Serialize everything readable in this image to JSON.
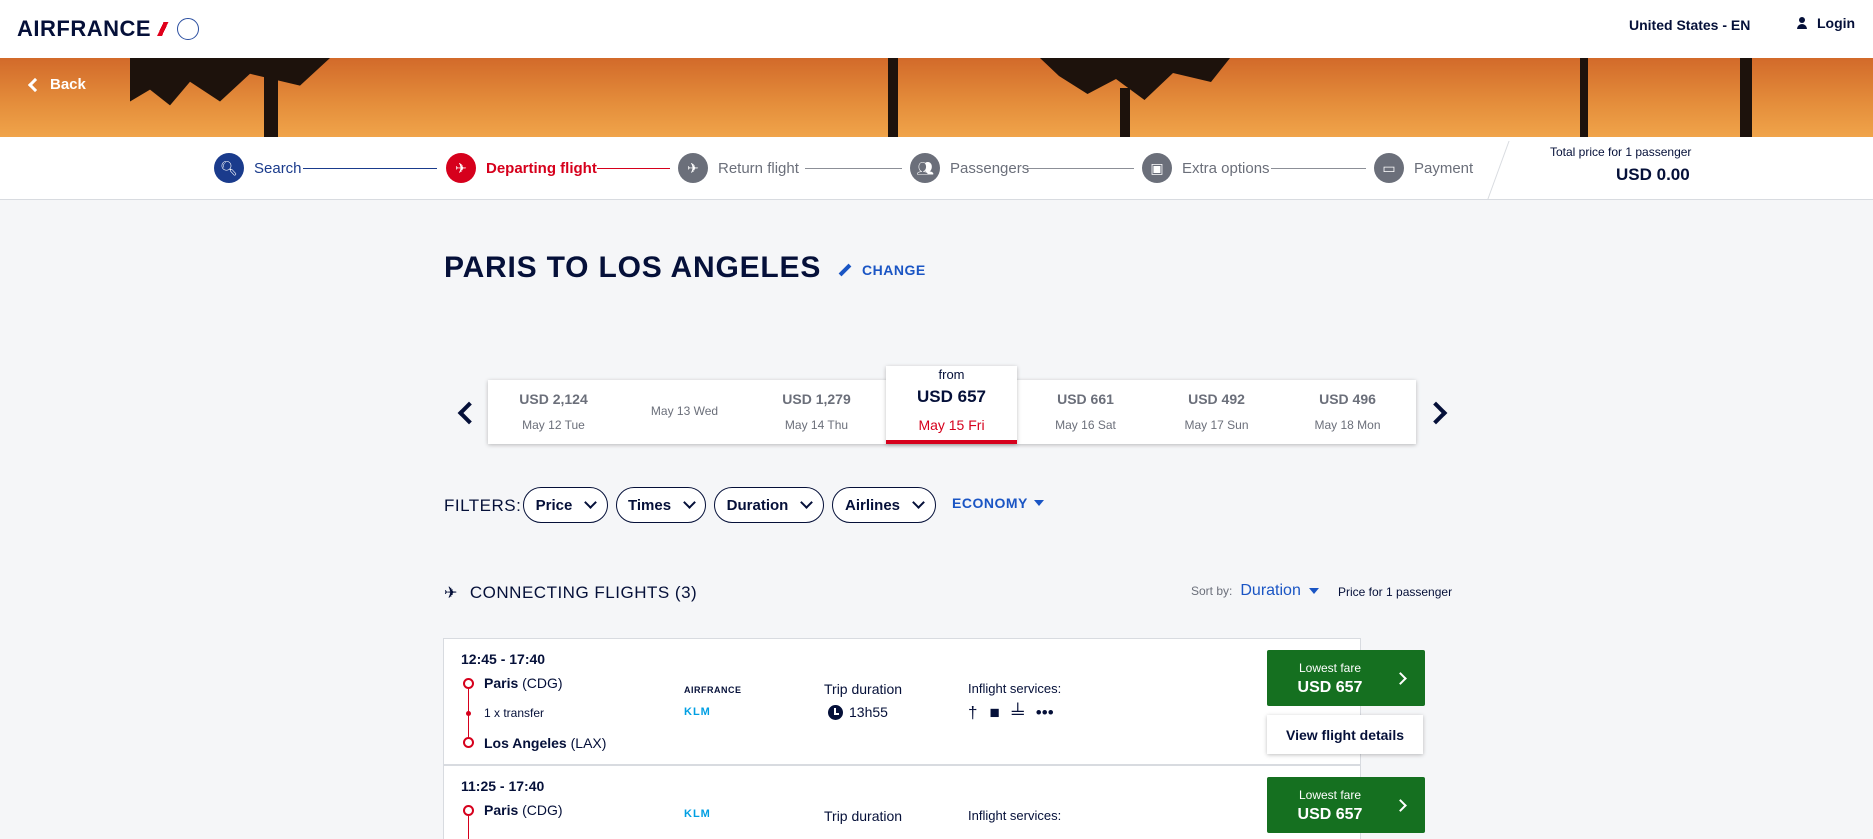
{
  "header": {
    "logo_text": "AIRFRANCE",
    "locale": "United States - EN",
    "login": "Login"
  },
  "hero": {
    "back": "Back"
  },
  "stepper": {
    "steps": [
      {
        "label": "Search",
        "state": "done",
        "icon": "search-icon"
      },
      {
        "label": "Departing flight",
        "state": "active",
        "icon": "plane-icon"
      },
      {
        "label": "Return flight",
        "state": "todo",
        "icon": "plane-icon"
      },
      {
        "label": "Passengers",
        "state": "todo",
        "icon": "passengers-icon"
      },
      {
        "label": "Extra options",
        "state": "todo",
        "icon": "suitcase-icon"
      },
      {
        "label": "Payment",
        "state": "todo",
        "icon": "card-icon"
      }
    ],
    "total_label": "Total price for 1 passenger",
    "total_value": "USD 0.00"
  },
  "route": {
    "title": "PARIS TO LOS ANGELES",
    "change": "CHANGE"
  },
  "dates": [
    {
      "price": "USD 2,124",
      "day": "May 12 Tue"
    },
    {
      "price": "",
      "day": "May 13 Wed"
    },
    {
      "price": "USD 1,279",
      "day": "May 14 Thu"
    },
    {
      "price": "USD 661",
      "day": "May 16 Sat"
    },
    {
      "price": "USD 492",
      "day": "May 17 Sun"
    },
    {
      "price": "USD 496",
      "day": "May 18 Mon"
    }
  ],
  "selected_date": {
    "from": "from",
    "price": "USD 657",
    "day": "May 15 Fri"
  },
  "filters": {
    "label": "FILTERS:",
    "pills": [
      "Price",
      "Times",
      "Duration",
      "Airlines"
    ],
    "cabin": "ECONOMY"
  },
  "results": {
    "heading": "CONNECTING FLIGHTS (3)",
    "sort_label": "Sort by:",
    "sort_value": "Duration",
    "price_for": "Price for 1 passenger"
  },
  "flights": [
    {
      "times": "12:45 - 17:40",
      "origin_city": "Paris",
      "origin_code": "(CDG)",
      "transfer": "1 x transfer",
      "dest_city": "Los Angeles",
      "dest_code": "(LAX)",
      "airline_1": "AIRFRANCE",
      "airline_2": "KLM",
      "trip_label": "Trip duration",
      "duration": "13h55",
      "services_label": "Inflight services:",
      "fare_label": "Lowest fare",
      "fare": "USD 657",
      "details": "View flight details"
    },
    {
      "times": "11:25 - 17:40",
      "origin_city": "Paris",
      "origin_code": "(CDG)",
      "airline_1": "KLM",
      "trip_label": "Trip duration",
      "services_label": "Inflight services:",
      "fare_label": "Lowest fare",
      "fare": "USD 657"
    }
  ],
  "colors": {
    "brand_navy": "#051039",
    "brand_red": "#d6001c",
    "link_blue": "#1a55c4",
    "fare_green": "#157020"
  }
}
